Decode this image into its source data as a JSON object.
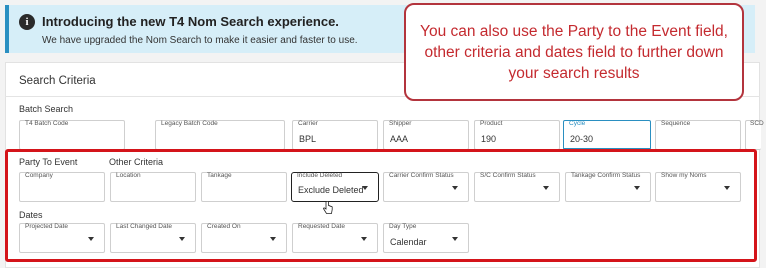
{
  "banner": {
    "icon": "info-icon",
    "title": "Introducing the new T4 Nom Search experience.",
    "subtitle": "We have upgraded the Nom Search to make it easier and faster to use."
  },
  "criteria": {
    "title": "Search Criteria"
  },
  "batch_search": {
    "label": "Batch Search",
    "fields": [
      {
        "label": "T4 Batch Code",
        "value": ""
      },
      {
        "label": "Legacy Batch Code",
        "value": ""
      },
      {
        "label": "Carrier",
        "value": "BPL"
      },
      {
        "label": "Shipper",
        "value": "AAA"
      },
      {
        "label": "Product",
        "value": "190"
      },
      {
        "label": "Cycle",
        "value": "20-30"
      },
      {
        "label": "Sequence",
        "value": ""
      },
      {
        "label": "SCD",
        "value": ""
      }
    ]
  },
  "party": {
    "label": "Party To Event",
    "other_label": "Other Criteria",
    "fields": [
      {
        "label": "Company",
        "value": ""
      },
      {
        "label": "Location",
        "value": ""
      },
      {
        "label": "Tankage",
        "value": ""
      },
      {
        "label": "Include Deleted",
        "value": "Exclude Deleted"
      },
      {
        "label": "Carrier Confirm Status",
        "value": ""
      },
      {
        "label": "S/C Confirm Status",
        "value": ""
      },
      {
        "label": "Tankage Confirm Status",
        "value": ""
      },
      {
        "label": "Show my Noms",
        "value": ""
      }
    ]
  },
  "dates": {
    "label": "Dates",
    "fields": [
      {
        "label": "Projected Date",
        "value": ""
      },
      {
        "label": "Last Changed Date",
        "value": ""
      },
      {
        "label": "Created On",
        "value": ""
      },
      {
        "label": "Requested Date",
        "value": ""
      },
      {
        "label": "Day Type",
        "value": "Calendar"
      }
    ]
  },
  "callout": {
    "text": "You can also use the Party to the Event field, other criteria and dates field to further down your search results"
  },
  "colors": {
    "annotation_red": "#d4141a",
    "banner_bg": "#d6eef8",
    "accent": "#2a8fc1"
  }
}
